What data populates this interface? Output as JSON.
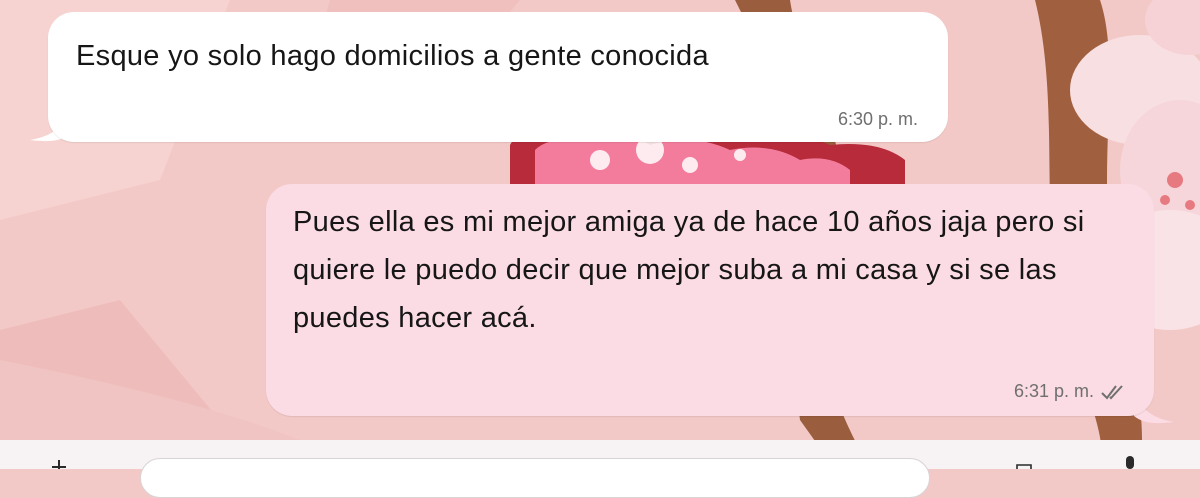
{
  "chat": {
    "messages": [
      {
        "direction": "incoming",
        "text": "Esque yo solo hago domicilios a gente conocida",
        "time": "6:30 p. m."
      },
      {
        "direction": "outgoing",
        "text": "Pues ella es mi mejor amiga ya de hace 10 años jaja pero si quiere le puedo decir que mejor suba a mi casa y si se las puedes hacer acá.",
        "time": "6:31 p. m.",
        "status": "read-double-check"
      }
    ]
  },
  "composer": {
    "message_value": "",
    "icons": [
      "plus-icon",
      "camera-icon",
      "microphone-icon"
    ]
  },
  "colors": {
    "wallpaper": "#f3c9c7",
    "incoming_bubble": "#ffffff",
    "outgoing_bubble": "#fbdbe4",
    "timestamp": "#6f6f6f"
  }
}
